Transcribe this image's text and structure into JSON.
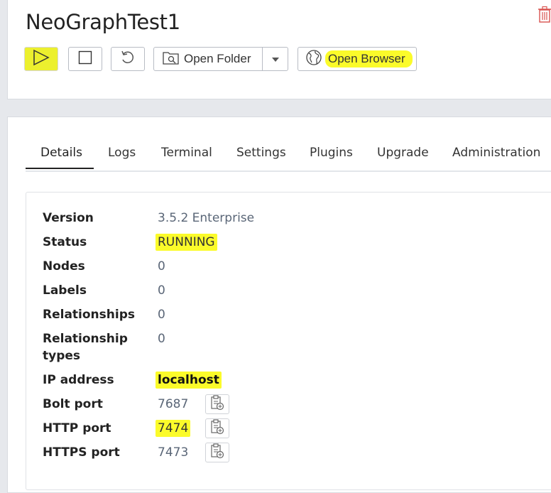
{
  "header": {
    "title": "NeoGraphTest1",
    "open_folder_label": "Open Folder",
    "open_browser_label": "Open Browser"
  },
  "tabs": [
    {
      "label": "Details",
      "active": true
    },
    {
      "label": "Logs"
    },
    {
      "label": "Terminal"
    },
    {
      "label": "Settings"
    },
    {
      "label": "Plugins"
    },
    {
      "label": "Upgrade"
    },
    {
      "label": "Administration"
    }
  ],
  "details": {
    "version": {
      "label": "Version",
      "value": "3.5.2 Enterprise"
    },
    "status": {
      "label": "Status",
      "value": "RUNNING"
    },
    "nodes": {
      "label": "Nodes",
      "value": "0"
    },
    "labels": {
      "label": "Labels",
      "value": "0"
    },
    "relationships": {
      "label": "Relationships",
      "value": "0"
    },
    "relationship_types": {
      "label": "Relationship types",
      "value": "0"
    },
    "ip_address": {
      "label": "IP address",
      "value": "localhost"
    },
    "bolt_port": {
      "label": "Bolt port",
      "value": "7687"
    },
    "http_port": {
      "label": "HTTP port",
      "value": "7474"
    },
    "https_port": {
      "label": "HTTPS port",
      "value": "7473"
    }
  },
  "colors": {
    "highlight": "#fbfb2a",
    "trash": "#d9534f",
    "value_text": "#5a6677"
  },
  "icons": [
    "play-icon",
    "stop-icon",
    "reset-icon",
    "folder-icon",
    "caret-down-icon",
    "globe-icon",
    "trash-icon",
    "clipboard-copy-icon"
  ]
}
